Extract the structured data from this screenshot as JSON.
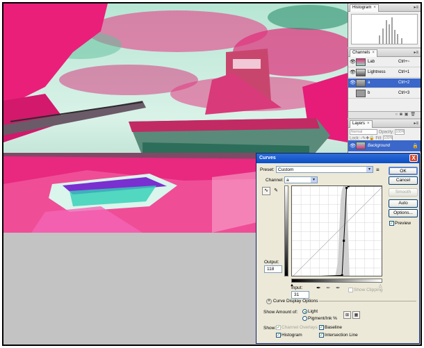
{
  "palettes": {
    "histogram": {
      "tab": "Histogram"
    },
    "channels": {
      "tab": "Channels",
      "rows": [
        {
          "name": "Lab",
          "key": "Ctrl+~",
          "selected": false
        },
        {
          "name": "Lightness",
          "key": "Ctrl+1",
          "selected": false
        },
        {
          "name": "a",
          "key": "Ctrl+2",
          "selected": true
        },
        {
          "name": "b",
          "key": "Ctrl+3",
          "selected": false
        }
      ]
    },
    "layers": {
      "tab": "Layers",
      "blend_mode": "Normal",
      "opacity_label": "Opacity:",
      "opacity_value": "100%",
      "lock_label": "Lock:",
      "fill_label": "Fill:",
      "fill_value": "100%",
      "layer_name": "Background"
    }
  },
  "curves": {
    "title": "Curves",
    "close": "X",
    "preset_label": "Preset:",
    "preset_value": "Custom",
    "channel_label": "Channel:",
    "channel_value": "a",
    "output_label": "Output:",
    "output_value": "118",
    "input_label": "Input:",
    "input_value": "31",
    "show_clipping": "Show Clipping",
    "display_options": "Curve Display Options",
    "show_amount_label": "Show Amount of:",
    "light": "Light",
    "pigment": "Pigment/Ink %",
    "show_label": "Show:",
    "channel_overlays": "Channel Overlays",
    "baseline": "Baseline",
    "histogram": "Histogram",
    "intersection": "Intersection Line",
    "buttons": {
      "ok": "OK",
      "cancel": "Cancel",
      "smooth": "Smooth",
      "auto": "Auto",
      "options": "Options...",
      "preview": "Preview"
    },
    "curve_points": [
      [
        0,
        0
      ],
      [
        0.55,
        0.02
      ],
      [
        0.57,
        0.4
      ],
      [
        0.6,
        0.98
      ],
      [
        0.62,
        1
      ],
      [
        1,
        1
      ]
    ]
  },
  "colors": {
    "accent": "#3a67c9",
    "title_bar": "#0a4fc7",
    "photo_magenta": "#e8207a",
    "photo_mint": "#8fd9c0"
  }
}
